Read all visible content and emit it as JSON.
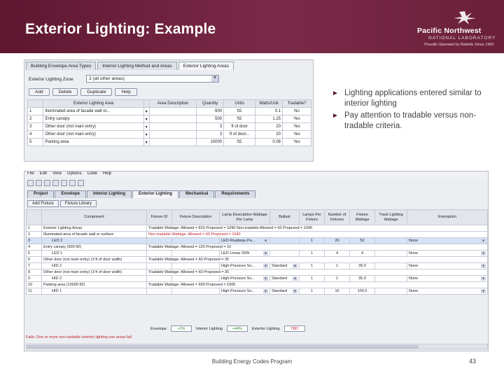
{
  "slide": {
    "title": "Exterior Lighting: Example",
    "logo": {
      "line1": "Pacific Northwest",
      "line2": "NATIONAL LABORATORY",
      "line3": "Proudly Operated by Battelle Since 1965"
    },
    "bullets": [
      "Lighting applications entered similar to interior lighting",
      "Pay attention to tradable versus non-tradable criteria."
    ],
    "footer": "Building Energy Codes Program",
    "page_number": "43",
    "colors": {
      "header": "#6a1f3a",
      "accent": "#5e1730",
      "fail_text": "#c0242e",
      "pass_text": "#2e8b2e"
    }
  },
  "screenshot1": {
    "tabs": [
      "Building Envelope Area Types",
      "Interior Lighting Method and Areas",
      "Exterior Lighting Areas"
    ],
    "zone_label": "Exterior Lighting Zone",
    "zone_value": "3 (all other areas)",
    "buttons": [
      "Add",
      "Delete",
      "Duplicate",
      "Help"
    ],
    "headers": [
      "",
      "Exterior Lighting Area",
      "",
      "Area Description",
      "Quantity",
      "Units",
      "Watts/Unit",
      "Tradable?"
    ],
    "rows": [
      [
        "1",
        "Illuminated area of facade wall or...",
        "600",
        "ft2",
        "0.1",
        "No"
      ],
      [
        "2",
        "Entry canopy",
        "500",
        "ft2",
        "1.25",
        "Yes"
      ],
      [
        "3",
        "Other door (not main entry)",
        "3",
        "ft of door",
        "20",
        "Yes"
      ],
      [
        "4",
        "Other door (not main entry)",
        "3",
        "ft of door...",
        "20",
        "Yes"
      ],
      [
        "5",
        "Parking area",
        "10000",
        "ft2",
        "0.06",
        "Yes"
      ]
    ]
  },
  "screenshot2": {
    "menu": [
      "File",
      "Edit",
      "View",
      "Options",
      "Code",
      "Help"
    ],
    "tabs": [
      "Project",
      "Envelope",
      "Interior Lighting",
      "Exterior Lighting",
      "Mechanical",
      "Requirements"
    ],
    "buttons": [
      "Add Fixture",
      "Fixture Library"
    ],
    "headers": [
      "",
      "Component",
      "Fixture ID",
      "Fixture Description",
      "Lamp Description Wattage Per Lamp",
      "Ballast",
      "Lamps Per Fixture",
      "Number of Fixtures",
      "Fixture Wattage",
      "Track Lighting Wattage",
      "Exemption"
    ],
    "rows": [
      {
        "n": "1",
        "comp": "Exterior Lighting Areas",
        "note": "Tradable Wattage: Allowed = 815   Proposed = 1090   Non-tradable Allowed = 60 Proposed = 1040",
        "kind": "note"
      },
      {
        "n": "2",
        "comp": "Illuminated area of facade wall or surface",
        "note": "Non-tradable Wattage: Allowed = 60   Proposed = 1040",
        "kind": "red"
      },
      {
        "n": "3",
        "comp": "LED 2",
        "desc": "LED Roadway-Pa...",
        "ballast": "",
        "lamps": "1",
        "num": "20",
        "watt": "52",
        "exempt": "None",
        "kind": "sel"
      },
      {
        "n": "4",
        "comp": "Entry canopy (500 ft2)",
        "note": "Tradable Wattage: Allowed = 125   Proposed = 10",
        "kind": "note"
      },
      {
        "n": "5",
        "comp": "LED 1",
        "desc": "LED Linear 20W",
        "ballast": "",
        "lamps": "1",
        "num": "4",
        "watt": "4",
        "exempt": "None",
        "kind": "row"
      },
      {
        "n": "6",
        "comp": "Other door (not main entry) (3 ft of door width)",
        "note": "Tradable Wattage: Allowed = 60   Proposed = 35",
        "kind": "note"
      },
      {
        "n": "7",
        "comp": "HID 2",
        "desc": "High-Pressure So...",
        "ballast": "Standard",
        "lamps": "1",
        "num": "1",
        "watt": "35.0",
        "exempt": "None",
        "kind": "row"
      },
      {
        "n": "8",
        "comp": "Other door (not main entry) (3 ft of door width)",
        "note": "Tradable Wattage: Allowed = 60   Proposed = 35",
        "kind": "note"
      },
      {
        "n": "9",
        "comp": "HID 2",
        "desc": "High-Pressure So...",
        "ballast": "Standard",
        "lamps": "1",
        "num": "1",
        "watt": "35.0",
        "exempt": "None",
        "kind": "row"
      },
      {
        "n": "10",
        "comp": "Parking area (10000 ft2)",
        "note": "Tradable Wattage: Allowed = 600   Proposed = 1000",
        "kind": "note"
      },
      {
        "n": "11",
        "comp": "HID 1",
        "desc": "High-Pressure So...",
        "ballast": "Standard",
        "lamps": "1",
        "num": "10",
        "watt": "100.0",
        "exempt": "None",
        "kind": "row"
      }
    ],
    "summary": {
      "envelope_label": "Envelope",
      "envelope_value": "+2%",
      "interior_label": "Interior Lighting",
      "interior_value": "+44%",
      "exterior_label": "Exterior Lighting",
      "exterior_value": "TBD"
    },
    "fail_message": "Fails: One or more non-tradable exterior lighting use areas fail"
  }
}
